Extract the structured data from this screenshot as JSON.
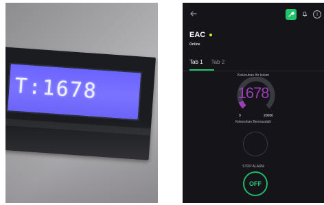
{
  "photo": {
    "lcd_reading": "T:1678"
  },
  "app": {
    "device_name": "EAC",
    "device_status": "Online",
    "tabs": [
      {
        "label": "Tab 1",
        "active": true
      },
      {
        "label": "Tab 2",
        "active": false
      }
    ],
    "gauge": {
      "label": "Kekeruhan Air kolam",
      "value": "1678",
      "min": "0",
      "max": "20000",
      "fraction": 0.0839
    },
    "led": {
      "label": "Kekeruhan Bermasalah"
    },
    "alarm": {
      "label": "STOP ALARM",
      "button_text": "OFF"
    },
    "icons": {
      "back": "back-arrow-icon",
      "settings": "wrench-icon",
      "notifications": "bell-icon",
      "info": "info-icon"
    },
    "colors": {
      "background": "#141419",
      "accent_green": "#21c36b",
      "gauge_purple": "#9a3fb5",
      "status_dot": "#d6e83a",
      "lcd_blue": "#6b63ff"
    }
  }
}
